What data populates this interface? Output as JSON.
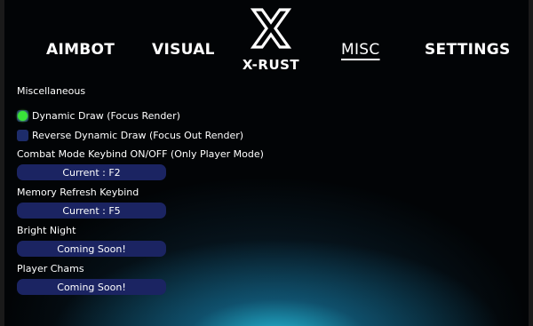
{
  "nav": {
    "tabs": [
      {
        "id": "aimbot",
        "label": "AIMBOT"
      },
      {
        "id": "visual",
        "label": "VISUAL"
      },
      {
        "id": "misc",
        "label": "MISC",
        "active": true
      },
      {
        "id": "settings",
        "label": "SETTINGS"
      }
    ]
  },
  "brand": {
    "logo_icon": "x-logo-icon",
    "name": "X-RUST"
  },
  "misc": {
    "section_title": "Miscellaneous",
    "options": [
      {
        "label": "Dynamic Draw (Focus Render)",
        "checked": true
      },
      {
        "label": "Reverse Dynamic Draw (Focus Out Render)",
        "checked": false
      }
    ],
    "settings": [
      {
        "label": "Combat Mode Keybind ON/OFF (Only Player Mode)",
        "button": "Current : F2"
      },
      {
        "label": "Memory Refresh Keybind",
        "button": "Current : F5"
      },
      {
        "label": "Bright Night",
        "button": "Coming Soon!"
      },
      {
        "label": "Player Chams",
        "button": "Coming Soon!"
      }
    ]
  },
  "colors": {
    "accent_glow": "#28d2f0",
    "checkbox_off": "#1d2c6a",
    "checkbox_on": "#39e23a",
    "button_bg": "#1b2462",
    "background": "#020406"
  }
}
